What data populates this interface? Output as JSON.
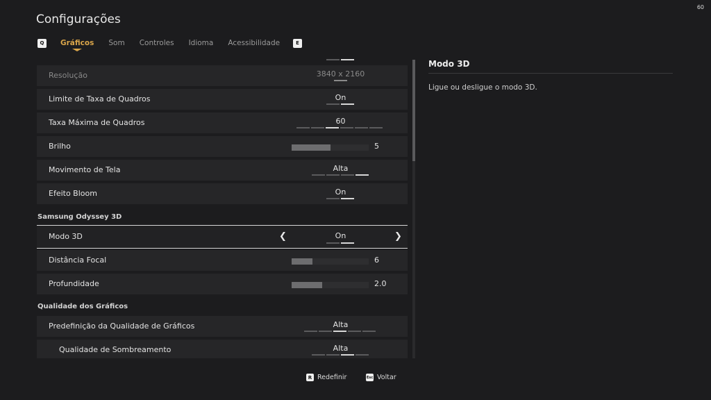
{
  "fps_counter": "60",
  "title": "Configurações",
  "tabs": {
    "prev_key": "Q",
    "next_key": "E",
    "items": [
      "Gráficos",
      "Som",
      "Controles",
      "Idioma",
      "Acessibilidade"
    ],
    "active": "Gráficos"
  },
  "settings": {
    "resolution": {
      "label": "Resolução",
      "value": "3840 x 2160",
      "disabled": true
    },
    "frame_limit": {
      "label": "Limite de Taxa de Quadros",
      "value": "On"
    },
    "max_frame_rate": {
      "label": "Taxa Máxima de Quadros",
      "value": "60"
    },
    "brightness": {
      "label": "Brilho",
      "value": "5",
      "fill_fraction": 0.5
    },
    "screen_motion": {
      "label": "Movimento de Tela",
      "value": "Alta"
    },
    "bloom": {
      "label": "Efeito Bloom",
      "value": "On"
    },
    "section_samsung": "Samsung Odyssey 3D",
    "mode_3d": {
      "label": "Modo 3D",
      "value": "On",
      "selected": true
    },
    "focal_distance": {
      "label": "Distância Focal",
      "value": "6",
      "fill_fraction": 0.27
    },
    "depth": {
      "label": "Profundidade",
      "value": "2.0",
      "fill_fraction": 0.4
    },
    "section_quality": "Qualidade dos Gráficos",
    "quality_preset": {
      "label": "Predefinição da Qualidade de Gráficos",
      "value": "Alta"
    },
    "shading_quality": {
      "label": "Qualidade de Sombreamento",
      "value": "Alta"
    }
  },
  "detail": {
    "title": "Modo 3D",
    "description": "Ligue ou desligue o modo 3D."
  },
  "footer": {
    "reset_key": "R",
    "reset_label": "Redefinir",
    "back_key": "Esc",
    "back_label": "Voltar"
  },
  "colors": {
    "accent": "#d9a54a",
    "background": "#1c1c1e",
    "row": "#262628"
  }
}
